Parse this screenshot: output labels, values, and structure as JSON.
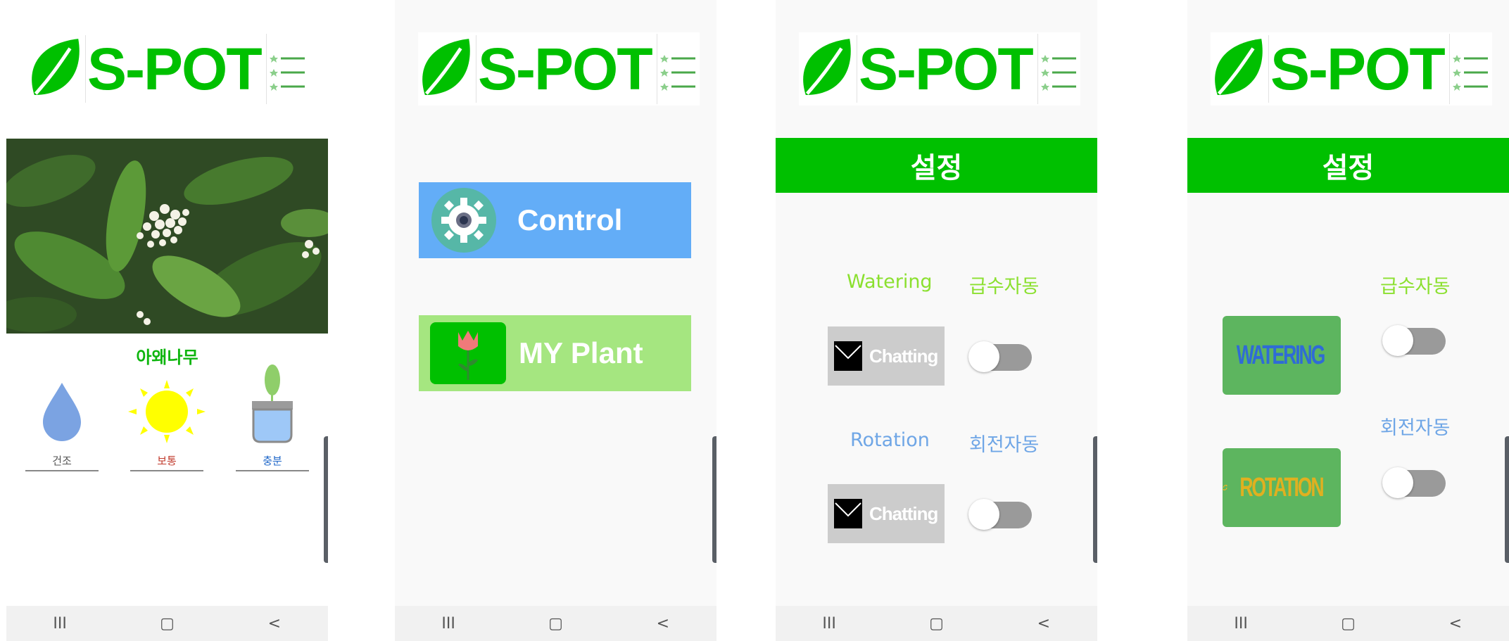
{
  "brand": {
    "name": "S-POT",
    "color": "#00c000"
  },
  "navbar": {
    "recent_icon": "III",
    "home_icon": "▢",
    "back_icon": "<"
  },
  "screen1": {
    "plant_name": "아왜나무",
    "stats": [
      {
        "icon": "water-drop-icon",
        "label": "건조",
        "color": "#555555"
      },
      {
        "icon": "sun-icon",
        "label": "보통",
        "color": "#c0392b"
      },
      {
        "icon": "pot-icon",
        "label": "충분",
        "color": "#1e66c8"
      }
    ]
  },
  "screen2": {
    "control_label": "Control",
    "myplant_label": "MY Plant",
    "control_color": "#63adf7",
    "myplant_color": "#a5e680"
  },
  "screen3": {
    "title": "설정",
    "watering_label": "Watering",
    "watering_auto_label": "급수자동",
    "rotation_label": "Rotation",
    "rotation_auto_label": "회전자동",
    "chat1_label": "Chatting",
    "chat2_label": "Chatting",
    "watering_toggle_on": false,
    "rotation_toggle_on": false
  },
  "screen4": {
    "title": "설정",
    "watering_auto_label": "급수자동",
    "rotation_auto_label": "회전자동",
    "watering_btn_label": "WATERING",
    "rotation_btn_label": "ROTATION",
    "watering_toggle_on": false,
    "rotation_toggle_on": false
  }
}
